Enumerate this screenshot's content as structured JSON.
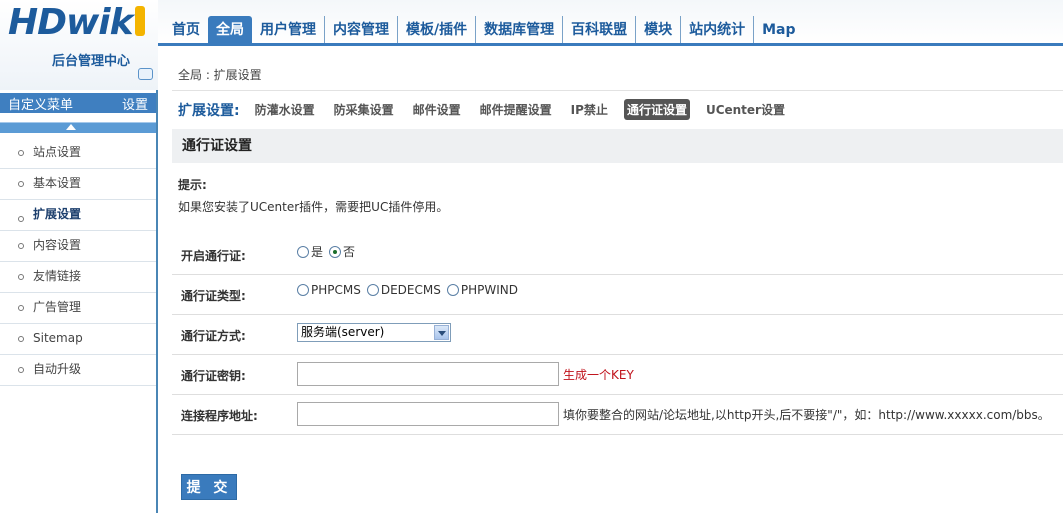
{
  "logo": {
    "brand": "HDwik",
    "subtitle": "后台管理中心"
  },
  "sidebar": {
    "header_title": "自定义菜单",
    "header_action": "设置",
    "items": [
      {
        "label": "站点设置"
      },
      {
        "label": "基本设置"
      },
      {
        "label": "扩展设置"
      },
      {
        "label": "内容设置"
      },
      {
        "label": "友情链接"
      },
      {
        "label": "广告管理"
      },
      {
        "label": "Sitemap"
      },
      {
        "label": "自动升级"
      }
    ],
    "active_index": 2
  },
  "topnav": {
    "items": [
      {
        "label": "首页"
      },
      {
        "label": "全局"
      },
      {
        "label": "用户管理"
      },
      {
        "label": "内容管理"
      },
      {
        "label": "模板/插件"
      },
      {
        "label": "数据库管理"
      },
      {
        "label": "百科联盟"
      },
      {
        "label": "模块"
      },
      {
        "label": "站内统计"
      },
      {
        "label": "Map"
      }
    ],
    "active_index": 1
  },
  "breadcrumb": "全局 : 扩展设置",
  "subnav": {
    "label": "扩展设置:",
    "items": [
      {
        "label": "防灌水设置"
      },
      {
        "label": "防采集设置"
      },
      {
        "label": "邮件设置"
      },
      {
        "label": "邮件提醒设置"
      },
      {
        "label": "IP禁止"
      },
      {
        "label": "通行证设置"
      },
      {
        "label": "UCenter设置"
      }
    ],
    "active_index": 5
  },
  "section_title": "通行证设置",
  "hint": {
    "label": "提示:",
    "text": "如果您安装了UCenter插件，需要把UC插件停用。"
  },
  "form": {
    "enable": {
      "label": "开启通行证:",
      "options": [
        "是",
        "否"
      ],
      "selected": "否"
    },
    "type": {
      "label": "通行证类型:",
      "options": [
        "PHPCMS",
        "DEDECMS",
        "PHPWIND"
      ]
    },
    "mode": {
      "label": "通行证方式:",
      "value": "服务端(server)"
    },
    "key": {
      "label": "通行证密钥:",
      "value": "",
      "generate_link": "生成一个KEY"
    },
    "address": {
      "label": "连接程序地址:",
      "value": "",
      "hint": "填你要整合的网站/论坛地址,以http开头,后不要接\"/\"，如：http://www.xxxxx.com/bbs。"
    },
    "submit_label": "提 交"
  },
  "colors": {
    "accent": "#3a7bbd",
    "brand": "#1d5b9c",
    "link_red": "#c0121b"
  }
}
